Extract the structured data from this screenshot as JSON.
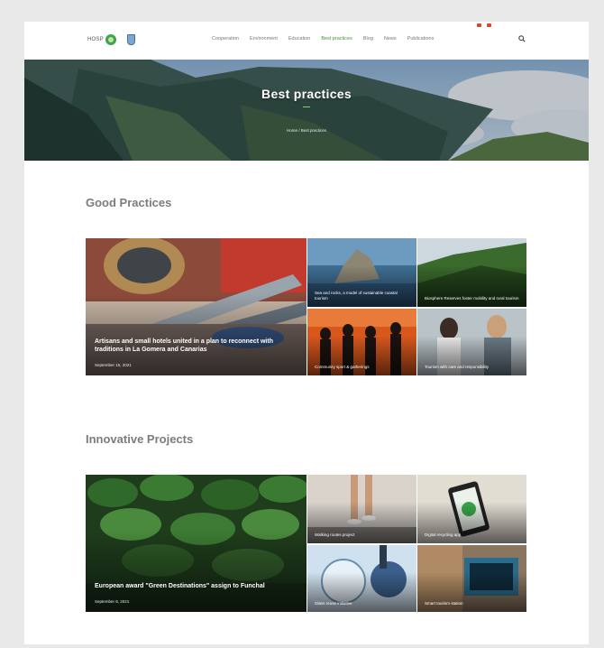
{
  "header": {
    "logo_text": "HOSP",
    "nav": [
      "Cooperation",
      "Environment",
      "Education",
      "Best practices",
      "Blog",
      "News",
      "Publications"
    ],
    "active_index": 3
  },
  "hero": {
    "title": "Best practices",
    "breadcrumb": "Home / Best practices"
  },
  "sections": [
    {
      "title": "Good Practices",
      "featured": {
        "title": "Artisans and small hotels united in a plan to reconnect with traditions in La Gomera and Canarias",
        "date": "September 15, 2021"
      },
      "tiles": [
        "Sea and rocks, a model of sustainable coastal tourism",
        "Biosphere Reserves foster mobility and rural tourism",
        "Community sport & gatherings",
        "Tourism with care and responsibility"
      ]
    },
    {
      "title": "Innovative Projects",
      "featured": {
        "title": "European award \"Green Destinations\" assign to Funchal",
        "date": "September 8, 2021"
      },
      "tiles": [
        "Walking routes project",
        "Digital recycling app",
        "Glass reuse initiative",
        "Smart tourism station"
      ]
    }
  ],
  "colors": {
    "accent": "#4a8f3a",
    "section_title": "#7c7c7c"
  }
}
